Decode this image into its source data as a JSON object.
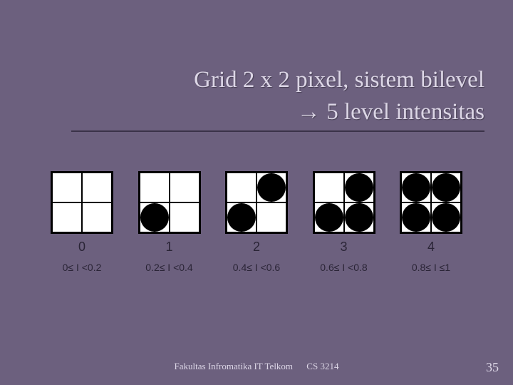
{
  "title": {
    "line1": "Grid 2 x 2 pixel, sistem bilevel",
    "line2": "→ 5 level intensitas"
  },
  "levels": [
    {
      "num": "0",
      "range": "0≤ I <0.2",
      "dots": [
        false,
        false,
        false,
        false
      ]
    },
    {
      "num": "1",
      "range": "0.2≤ I <0.4",
      "dots": [
        false,
        false,
        true,
        false
      ]
    },
    {
      "num": "2",
      "range": "0.4≤ I <0.6",
      "dots": [
        false,
        true,
        true,
        false
      ]
    },
    {
      "num": "3",
      "range": "0.6≤ I <0.8",
      "dots": [
        false,
        true,
        true,
        true
      ]
    },
    {
      "num": "4",
      "range": "0.8≤ I ≤1",
      "dots": [
        true,
        true,
        true,
        true
      ]
    }
  ],
  "footer": {
    "left": "Fakultas Infromatika IT Telkom",
    "right": "CS 3214"
  },
  "page": "35"
}
